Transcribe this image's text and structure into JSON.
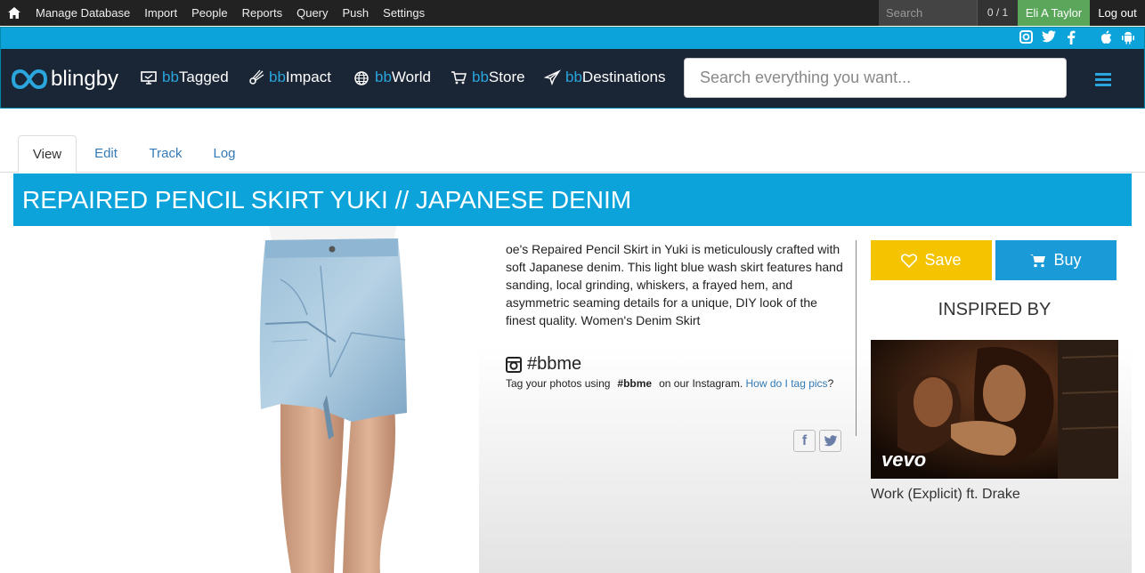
{
  "admin": {
    "menu": [
      "Manage Database",
      "Import",
      "People",
      "Reports",
      "Query",
      "Push",
      "Settings"
    ],
    "search_placeholder": "Search",
    "count": "0 / 1",
    "user": "Eli A Taylor",
    "logout": "Log out"
  },
  "header": {
    "logo": "blingby",
    "nav": [
      {
        "prefix": "bb",
        "label": "Tagged",
        "icon": "monitor-icon"
      },
      {
        "prefix": "bb",
        "label": "Impact",
        "icon": "comet-icon"
      },
      {
        "prefix": "bb",
        "label": "World",
        "icon": "globe-icon"
      },
      {
        "prefix": "bb",
        "label": "Store",
        "icon": "cart-icon"
      },
      {
        "prefix": "bb",
        "label": "Destinations",
        "icon": "plane-icon"
      }
    ],
    "search_placeholder": "Search everything you want..."
  },
  "tabs": [
    "View",
    "Edit",
    "Track",
    "Log"
  ],
  "page": {
    "title": "REPAIRED PENCIL SKIRT YUKI // JAPANESE DENIM",
    "description": "oe's Repaired Pencil Skirt in Yuki is meticulously crafted with soft Japanese denim. This light blue wash skirt features hand sanding, local grinding, whiskers, a frayed hem, and asymmetric seaming details for a unique, DIY look of the finest quality. Women's Denim Skirt",
    "hashtag": "#bbme",
    "tag_prefix": "Tag your photos using",
    "tag_bold": "#bbme",
    "tag_suffix": "on our Instagram.",
    "tag_link": "How do I tag pics",
    "tag_end": "?",
    "save": "Save",
    "buy": "Buy",
    "inspired_by": "INSPIRED BY",
    "video_brand": "vevo",
    "video_title": "Work (Explicit) ft. Drake"
  },
  "colors": {
    "accent": "#0ba3d9",
    "save": "#f5c400",
    "buy": "#1a9ad6",
    "nav_bg": "#1a2535"
  }
}
